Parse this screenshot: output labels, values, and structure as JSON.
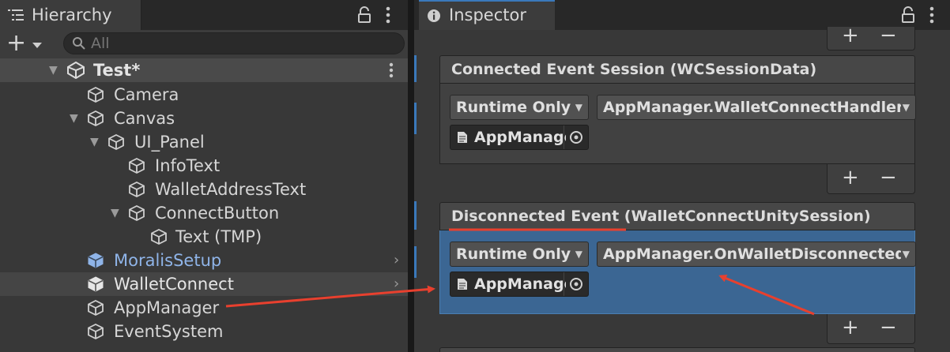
{
  "hierarchy": {
    "tab_title": "Hierarchy",
    "add_label": "+",
    "search_placeholder": "All",
    "scene_name": "Test*",
    "items": [
      {
        "label": "Camera"
      },
      {
        "label": "Canvas"
      },
      {
        "label": "UI_Panel"
      },
      {
        "label": "InfoText"
      },
      {
        "label": "WalletAddressText"
      },
      {
        "label": "ConnectButton"
      },
      {
        "label": "Text (TMP)"
      },
      {
        "label": "MoralisSetup"
      },
      {
        "label": "WalletConnect"
      },
      {
        "label": "AppManager"
      },
      {
        "label": "EventSystem"
      }
    ]
  },
  "inspector": {
    "tab_title": "Inspector",
    "plus_label": "+",
    "minus_label": "−",
    "events": [
      {
        "title": "Connected Event Session (WCSessionData)",
        "runtime_option": "Runtime Only",
        "function": "AppManager.WalletConnectHandler",
        "target_object": "AppManager"
      },
      {
        "title": "Disconnected Event (WalletConnectUnitySession)",
        "runtime_option": "Runtime Only",
        "function": "AppManager.OnWalletDisconnected",
        "target_object": "AppManager"
      }
    ]
  },
  "colors": {
    "selection_blue": "#3b6693",
    "tab_accent": "#3a79bb",
    "annotation_red": "#e8402e",
    "prefab_blue": "#8fb4e8"
  }
}
